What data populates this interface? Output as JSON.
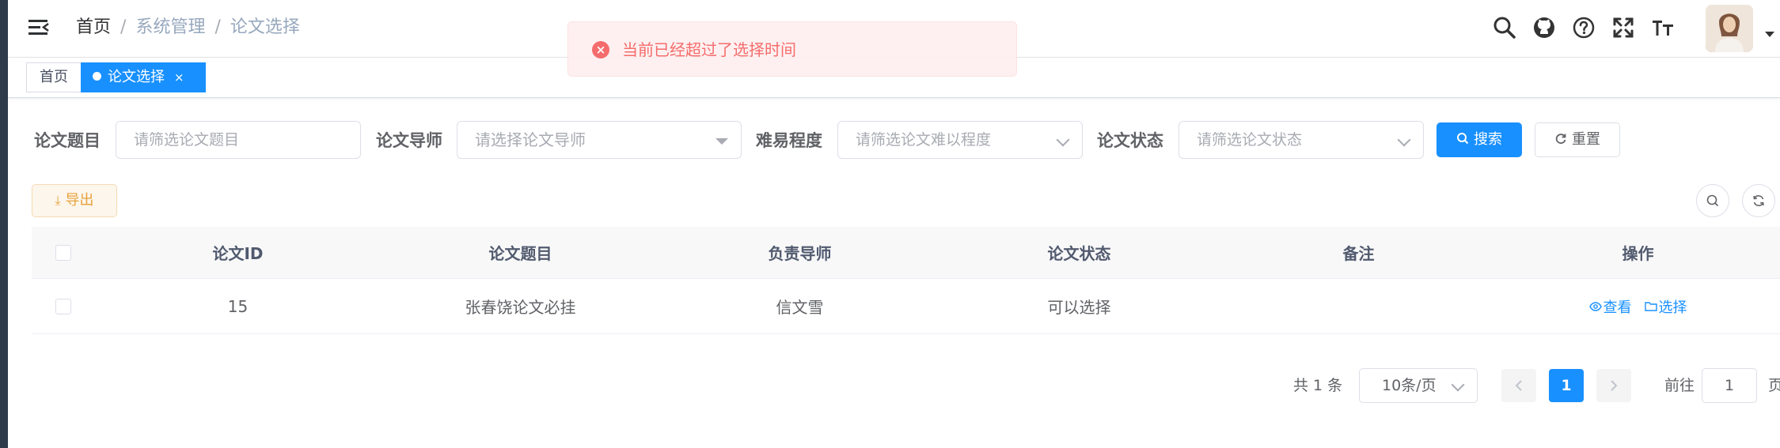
{
  "breadcrumb": {
    "home": "首页",
    "items": [
      "系统管理",
      "论文选择"
    ],
    "separator": "/"
  },
  "toast": {
    "message": "当前已经超过了选择时间",
    "type": "error",
    "icon": "close-circle-icon"
  },
  "nav_icons": [
    "search-icon",
    "github-icon",
    "question-icon",
    "fullscreen-icon",
    "font-size-icon"
  ],
  "tags": {
    "home": "首页",
    "active": "论文选择",
    "close": "×"
  },
  "search_form": {
    "title_label": "论文题目",
    "title_placeholder": "请筛选论文题目",
    "advisor_label": "论文导师",
    "advisor_placeholder": "请选择论文导师",
    "difficulty_label": "难易程度",
    "difficulty_placeholder": "请筛选论文难以程度",
    "status_label": "论文状态",
    "status_placeholder": "请筛选论文状态",
    "search_button": "搜索",
    "reset_button": "重置"
  },
  "toolbar": {
    "export_button": "导出"
  },
  "table": {
    "columns": [
      "论文ID",
      "论文题目",
      "负责导师",
      "论文状态",
      "备注",
      "操作"
    ],
    "rows": [
      {
        "id": "15",
        "title": "张春饶论文必挂",
        "advisor": "信文雪",
        "status": "可以选择",
        "remark": "",
        "view": "查看",
        "select": "选择"
      }
    ]
  },
  "pagination": {
    "total": "共 1 条",
    "page_size": "10条/页",
    "current_page": "1",
    "goto_label": "前往",
    "goto_value": "1",
    "page_suffix": "页"
  },
  "colors": {
    "primary": "#1890ff",
    "error": "#f56c6c",
    "warning": "#e6a23c",
    "sidebar": "#2f3b4b"
  }
}
